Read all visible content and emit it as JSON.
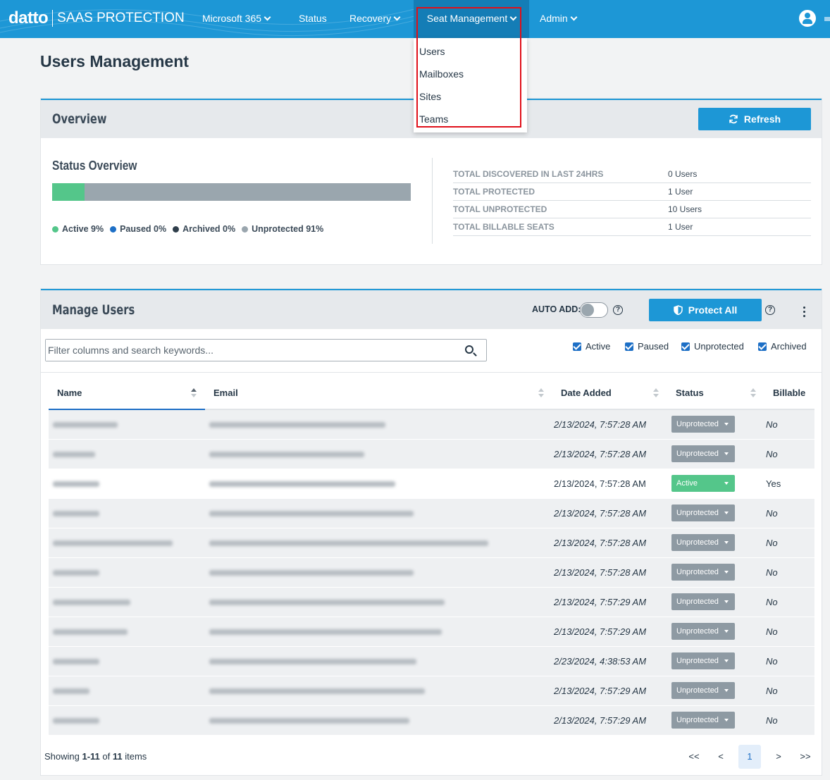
{
  "nav": {
    "brand": "datto",
    "product": "SAAS PROTECTION",
    "items": [
      "Microsoft 365",
      "Status",
      "Recovery",
      "Seat Management",
      "Admin"
    ]
  },
  "seat_menu": [
    "Users",
    "Mailboxes",
    "Sites",
    "Teams"
  ],
  "page_title": "Users Management",
  "overview": {
    "title": "Overview",
    "refresh_label": "Refresh",
    "status_title": "Status Overview",
    "active_fraction": 0.09,
    "legend": [
      {
        "label": "Active 9%",
        "color": "#54c68a"
      },
      {
        "label": "Paused 0%",
        "color": "#1d6fc6"
      },
      {
        "label": "Archived 0%",
        "color": "#2f3e4b"
      },
      {
        "label": "Unprotected 91%",
        "color": "#9aa6ae"
      }
    ],
    "stats": [
      {
        "k": "TOTAL DISCOVERED IN LAST 24HRS",
        "v": "0 Users"
      },
      {
        "k": "TOTAL PROTECTED",
        "v": "1 User"
      },
      {
        "k": "TOTAL UNPROTECTED",
        "v": "10 Users"
      },
      {
        "k": "TOTAL BILLABLE SEATS",
        "v": "1 User"
      }
    ]
  },
  "manage": {
    "title": "Manage Users",
    "auto_add_label": "AUTO ADD:",
    "protect_all_label": "Protect All",
    "search_placeholder": "Filter columns and search keywords...",
    "filters": [
      "Active",
      "Paused",
      "Unprotected",
      "Archived"
    ],
    "columns": [
      "Name",
      "Email",
      "Date Added",
      "Status",
      "Billable"
    ],
    "rows": [
      {
        "date": "2/13/2024, 7:57:28 AM",
        "status": "Unprotected",
        "billable": "No"
      },
      {
        "date": "2/13/2024, 7:57:28 AM",
        "status": "Unprotected",
        "billable": "No"
      },
      {
        "date": "2/13/2024, 7:57:28 AM",
        "status": "Active",
        "billable": "Yes"
      },
      {
        "date": "2/13/2024, 7:57:28 AM",
        "status": "Unprotected",
        "billable": "No"
      },
      {
        "date": "2/13/2024, 7:57:28 AM",
        "status": "Unprotected",
        "billable": "No"
      },
      {
        "date": "2/13/2024, 7:57:28 AM",
        "status": "Unprotected",
        "billable": "No"
      },
      {
        "date": "2/13/2024, 7:57:29 AM",
        "status": "Unprotected",
        "billable": "No"
      },
      {
        "date": "2/13/2024, 7:57:29 AM",
        "status": "Unprotected",
        "billable": "No"
      },
      {
        "date": "2/23/2024, 4:38:53 AM",
        "status": "Unprotected",
        "billable": "No"
      },
      {
        "date": "2/13/2024, 7:57:29 AM",
        "status": "Unprotected",
        "billable": "No"
      },
      {
        "date": "2/13/2024, 7:57:29 AM",
        "status": "Unprotected",
        "billable": "No"
      }
    ],
    "footer": {
      "prefix": "Showing ",
      "range": "1-11",
      "mid": " of ",
      "total": "11",
      "suffix": " items"
    },
    "pager": {
      "first": "<<",
      "prev": "<",
      "current": "1",
      "next": ">",
      "last": ">>"
    }
  },
  "colors": {
    "brand_blue": "#1d97d6",
    "active_green": "#54c68a",
    "highlight_red": "#e0101a"
  }
}
